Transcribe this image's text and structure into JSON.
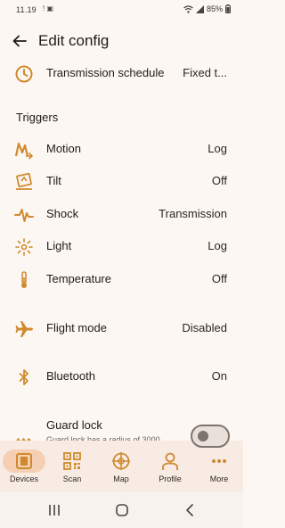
{
  "status_bar": {
    "time": "11.19",
    "left_glyphs": "! ▣",
    "battery": "85%"
  },
  "header": {
    "title": "Edit config",
    "back_icon": "arrow-back-icon"
  },
  "colors": {
    "accent": "#cf8a2e",
    "background": "#fdf7f3",
    "nav_background": "#f8ebe4",
    "nav_active_pill": "#f5cfb3"
  },
  "schedule_row": {
    "label": "Transmission schedule",
    "value": "Fixed t...",
    "icon": "clock-icon"
  },
  "triggers": {
    "title": "Triggers",
    "items": [
      {
        "label": "Motion",
        "value": "Log",
        "icon": "motion-icon"
      },
      {
        "label": "Tilt",
        "value": "Off",
        "icon": "tilt-icon"
      },
      {
        "label": "Shock",
        "value": "Transmission",
        "icon": "shock-icon"
      },
      {
        "label": "Light",
        "value": "Log",
        "icon": "light-icon"
      },
      {
        "label": "Temperature",
        "value": "Off",
        "icon": "thermometer-icon"
      }
    ]
  },
  "flight_mode": {
    "label": "Flight mode",
    "value": "Disabled",
    "icon": "airplane-icon"
  },
  "bluetooth": {
    "label": "Bluetooth",
    "value": "On",
    "icon": "bluetooth-icon"
  },
  "guard_lock": {
    "label": "Guard lock",
    "subtitle": "Guard lock has a radius of 3000",
    "icon": "fence-icon",
    "enabled": false
  },
  "bottom_nav": {
    "items": [
      {
        "label": "Devices",
        "icon": "devices-icon",
        "active": true
      },
      {
        "label": "Scan",
        "icon": "qr-scan-icon",
        "active": false
      },
      {
        "label": "Map",
        "icon": "map-icon",
        "active": false
      },
      {
        "label": "Profile",
        "icon": "profile-icon",
        "active": false
      },
      {
        "label": "More",
        "icon": "more-icon",
        "active": false
      }
    ]
  },
  "system_nav": {
    "recents_icon": "recents-icon",
    "home_icon": "home-icon",
    "back_icon": "system-back-icon"
  }
}
